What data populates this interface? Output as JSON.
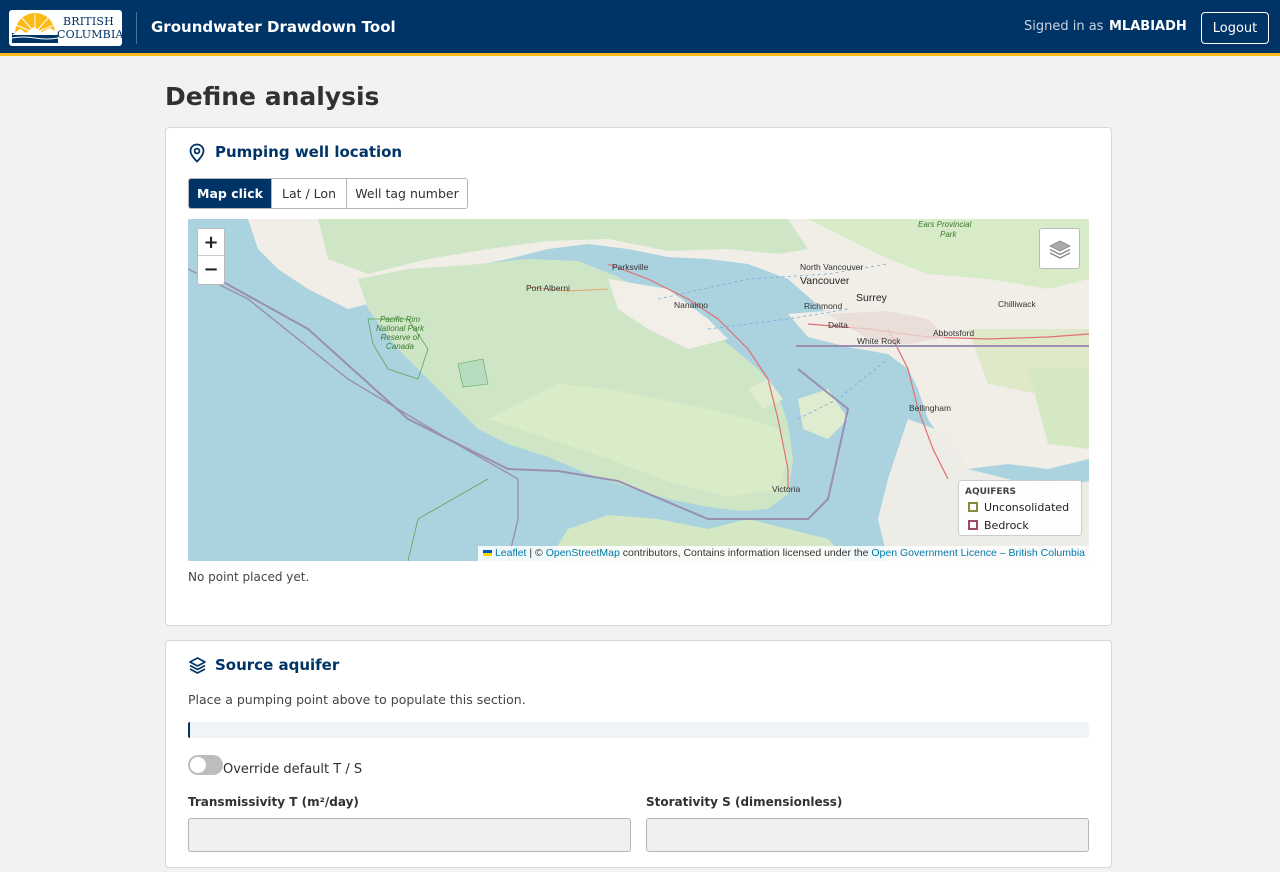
{
  "header": {
    "logo_line1": "BRITISH",
    "logo_line2": "COLUMBIA",
    "app_title": "Groundwater Drawdown Tool",
    "signed_in_label": "Signed in as",
    "username": "MLABIADH",
    "logout_label": "Logout"
  },
  "page_title": "Define analysis",
  "location_card": {
    "title": "Pumping well location",
    "icon": "map-pin-icon",
    "tabs": [
      {
        "label": "Map click",
        "active": true
      },
      {
        "label": "Lat / Lon",
        "active": false
      },
      {
        "label": "Well tag number",
        "active": false
      }
    ],
    "map": {
      "zoom_in": "+",
      "zoom_out": "−",
      "layers_icon": "layers-icon",
      "legend_title": "AQUIFERS",
      "legend": [
        {
          "label": "Unconsolidated",
          "color": "#8a8a3c"
        },
        {
          "label": "Bedrock",
          "color": "#a0456e"
        }
      ],
      "attribution": {
        "leaflet": "Leaflet",
        "sep": " | © ",
        "osm": "OpenStreetMap",
        "mid": " contributors, Contains information licensed under the ",
        "licence": "Open Government Licence – British Columbia"
      },
      "labels": {
        "parksville": "Parksville",
        "port_alberni": "Port Alberni",
        "nanaimo": "Nanaimo",
        "north_vancouver": "North Vancouver",
        "vancouver": "Vancouver",
        "surrey": "Surrey",
        "richmond": "Richmond",
        "delta": "Delta",
        "white_rock": "White Rock",
        "abbotsford": "Abbotsford",
        "chilliwack": "Chilliwack",
        "bellingham": "Bellingham",
        "victoria": "Victoria",
        "ears_park_1": "Ears Provincial",
        "ears_park_2": "Park",
        "pacific_rim": "Pacific Rim National Park Reserve of Canada"
      }
    },
    "status": "No point placed yet."
  },
  "aquifer_card": {
    "title": "Source aquifer",
    "icon": "layers-stack-icon",
    "hint": "Place a pumping point above to populate this section.",
    "progress": 0.002,
    "override_label": "Override default T / S",
    "override_on": false,
    "transmissivity_label": "Transmissivity T (m²/day)",
    "transmissivity_value": "",
    "storativity_label": "Storativity S (dimensionless)",
    "storativity_value": ""
  }
}
